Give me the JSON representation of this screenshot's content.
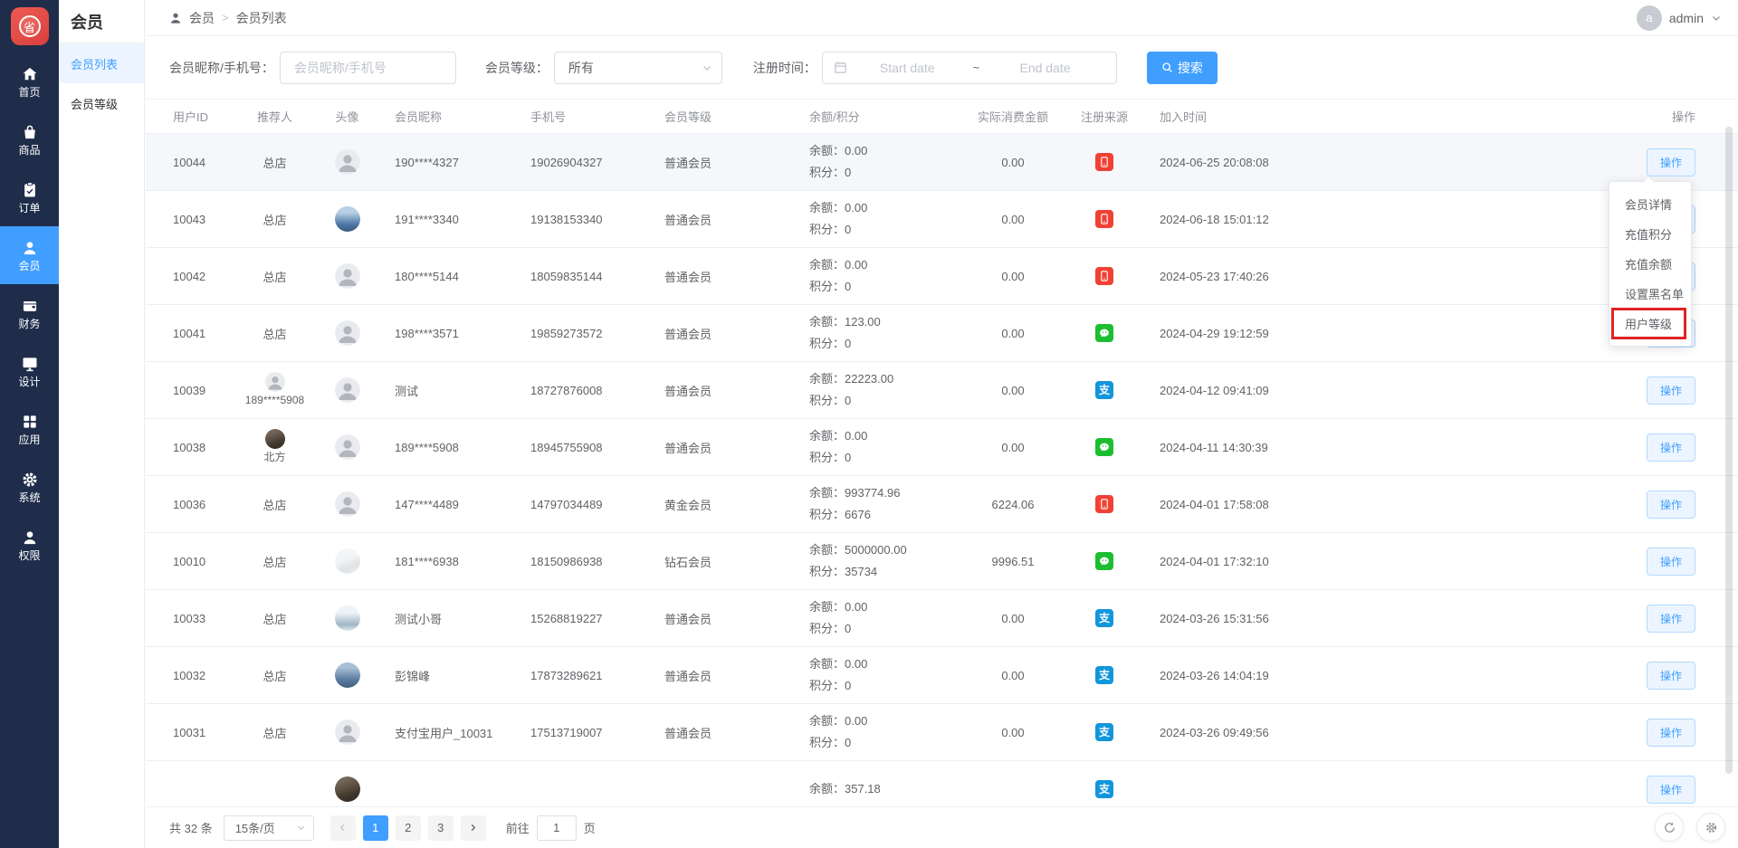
{
  "app": {
    "logo_char": "省",
    "user": {
      "avatar_letter": "a",
      "name": "admin"
    }
  },
  "primary_nav": [
    {
      "id": "home",
      "label": "首页",
      "active": false
    },
    {
      "id": "goods",
      "label": "商品",
      "active": false
    },
    {
      "id": "orders",
      "label": "订单",
      "active": false
    },
    {
      "id": "members",
      "label": "会员",
      "active": true
    },
    {
      "id": "finance",
      "label": "财务",
      "active": false
    },
    {
      "id": "design",
      "label": "设计",
      "active": false
    },
    {
      "id": "apps",
      "label": "应用",
      "active": false
    },
    {
      "id": "system",
      "label": "系统",
      "active": false
    },
    {
      "id": "permissions",
      "label": "权限",
      "active": false
    }
  ],
  "secondary_nav": {
    "title": "会员",
    "items": [
      {
        "label": "会员列表",
        "active": true
      },
      {
        "label": "会员等级",
        "active": false
      }
    ]
  },
  "breadcrumb": {
    "root": "会员",
    "separator": ">",
    "current": "会员列表"
  },
  "filters": {
    "nickname_label": "会员昵称/手机号：",
    "nickname_placeholder": "会员昵称/手机号",
    "level_label": "会员等级：",
    "level_value": "所有",
    "date_label": "注册时间：",
    "date_start_placeholder": "Start date",
    "date_separator": "~",
    "date_end_placeholder": "End date",
    "search_button": "搜索"
  },
  "table": {
    "columns": [
      "用户ID",
      "推荐人",
      "头像",
      "会员昵称",
      "手机号",
      "会员等级",
      "余额/积分",
      "实际消费金额",
      "注册来源",
      "加入时间",
      "操作"
    ],
    "balance_label": "余额：",
    "points_label": "积分：",
    "action_label": "操作",
    "rows": [
      {
        "id": "10044",
        "referrer": "总店",
        "referrer_avatar": "",
        "avatar": "default",
        "nickname": "190****4327",
        "phone": "19026904327",
        "level": "普通会员",
        "balance": "0.00",
        "points": "0",
        "consumed": "0.00",
        "source": "h5",
        "joined": "2024-06-25 20:08:08",
        "highlight": true,
        "partial": false
      },
      {
        "id": "10043",
        "referrer": "总店",
        "referrer_avatar": "",
        "avatar": "photo-blue",
        "nickname": "191****3340",
        "phone": "19138153340",
        "level": "普通会员",
        "balance": "0.00",
        "points": "0",
        "consumed": "0.00",
        "source": "h5",
        "joined": "2024-06-18 15:01:12",
        "highlight": false,
        "partial": false
      },
      {
        "id": "10042",
        "referrer": "总店",
        "referrer_avatar": "",
        "avatar": "default",
        "nickname": "180****5144",
        "phone": "18059835144",
        "level": "普通会员",
        "balance": "0.00",
        "points": "0",
        "consumed": "0.00",
        "source": "h5",
        "joined": "2024-05-23 17:40:26",
        "highlight": false,
        "partial": false
      },
      {
        "id": "10041",
        "referrer": "总店",
        "referrer_avatar": "",
        "avatar": "default",
        "nickname": "198****3571",
        "phone": "19859273572",
        "level": "普通会员",
        "balance": "123.00",
        "points": "0",
        "consumed": "0.00",
        "source": "wechat",
        "joined": "2024-04-29 19:12:59",
        "highlight": false,
        "partial": false
      },
      {
        "id": "10039",
        "referrer": "189****5908",
        "referrer_avatar": "default",
        "avatar": "default",
        "nickname": "测试",
        "phone": "18727876008",
        "level": "普通会员",
        "balance": "22223.00",
        "points": "0",
        "consumed": "0.00",
        "source": "alipay",
        "joined": "2024-04-12 09:41:09",
        "highlight": false,
        "partial": false
      },
      {
        "id": "10038",
        "referrer": "北方",
        "referrer_avatar": "photo-dark",
        "avatar": "default",
        "nickname": "189****5908",
        "phone": "18945755908",
        "level": "普通会员",
        "balance": "0.00",
        "points": "0",
        "consumed": "0.00",
        "source": "wechat",
        "joined": "2024-04-11 14:30:39",
        "highlight": false,
        "partial": false
      },
      {
        "id": "10036",
        "referrer": "总店",
        "referrer_avatar": "",
        "avatar": "default",
        "nickname": "147****4489",
        "phone": "14797034489",
        "level": "黄金会员",
        "balance": "993774.96",
        "points": "6676",
        "consumed": "6224.06",
        "source": "h5",
        "joined": "2024-04-01 17:58:08",
        "highlight": false,
        "partial": false
      },
      {
        "id": "10010",
        "referrer": "总店",
        "referrer_avatar": "",
        "avatar": "photo-light",
        "nickname": "181****6938",
        "phone": "18150986938",
        "level": "钻石会员",
        "balance": "5000000.00",
        "points": "35734",
        "consumed": "9996.51",
        "source": "wechat",
        "joined": "2024-04-01 17:32:10",
        "highlight": false,
        "partial": false
      },
      {
        "id": "10033",
        "referrer": "总店",
        "referrer_avatar": "",
        "avatar": "photo-figure",
        "nickname": "测试小哥",
        "phone": "15268819227",
        "level": "普通会员",
        "balance": "0.00",
        "points": "0",
        "consumed": "0.00",
        "source": "alipay",
        "joined": "2024-03-26 15:31:56",
        "highlight": false,
        "partial": false
      },
      {
        "id": "10032",
        "referrer": "总店",
        "referrer_avatar": "",
        "avatar": "photo-person",
        "nickname": "彭锦峰",
        "phone": "17873289621",
        "level": "普通会员",
        "balance": "0.00",
        "points": "0",
        "consumed": "0.00",
        "source": "alipay",
        "joined": "2024-03-26 14:04:19",
        "highlight": false,
        "partial": false
      },
      {
        "id": "10031",
        "referrer": "总店",
        "referrer_avatar": "",
        "avatar": "default",
        "nickname": "支付宝用户_10031",
        "phone": "17513719007",
        "level": "普通会员",
        "balance": "0.00",
        "points": "0",
        "consumed": "0.00",
        "source": "alipay",
        "joined": "2024-03-26 09:49:56",
        "highlight": false,
        "partial": false
      },
      {
        "id": "",
        "referrer": "",
        "referrer_avatar": "",
        "avatar": "photo-dark",
        "nickname": "",
        "phone": "",
        "level": "",
        "balance": "357.18",
        "points": "",
        "consumed": "",
        "source": "alipay",
        "joined": "",
        "highlight": false,
        "partial": true
      }
    ]
  },
  "action_menu": {
    "items": [
      {
        "label": "会员详情",
        "annotated": false
      },
      {
        "label": "充值积分",
        "annotated": false
      },
      {
        "label": "充值余额",
        "annotated": false
      },
      {
        "label": "设置黑名单",
        "annotated": false
      },
      {
        "label": "用户等级",
        "annotated": true
      }
    ]
  },
  "pagination": {
    "total_text": "共 32 条",
    "page_size": "15条/页",
    "pages": [
      "1",
      "2",
      "3"
    ],
    "current_page": "1",
    "goto_label": "前往",
    "goto_value": "1",
    "goto_unit": "页"
  },
  "colors": {
    "accent": "#409EFF",
    "sidebar": "#1f2d4a",
    "source_h5": "#f04134",
    "source_wechat": "#1cbe30",
    "source_alipay": "#1296db",
    "annotation": "#e12424",
    "row_highlight": "#f5f7fa"
  }
}
